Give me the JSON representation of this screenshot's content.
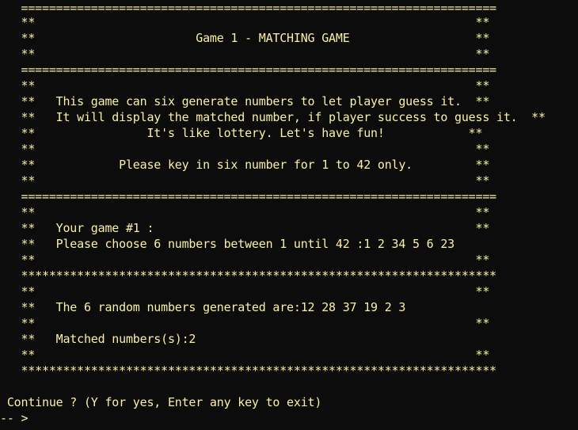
{
  "console": {
    "lines": [
      "   ====================================================================",
      "   **                                                               **",
      "   **                       Game 1 - MATCHING GAME                  **",
      "   **                                                               **",
      "",
      "   ====================================================================",
      "   **                                                               **",
      "   **   This game can six generate numbers to let player guess it.  **",
      "   **   It will display the matched number, if player success to guess it.  **",
      "   **                It's like lottery. Let's have fun!            **",
      "   **                                                               **",
      "   **            Please key in six number for 1 to 42 only.         **",
      "   **                                                               **",
      "   ====================================================================",
      "   **                                                               **",
      "   **   Your game #1 :                                              **",
      "   **   Please choose 6 numbers between 1 until 42 :1 2 34 5 6 23",
      "   **                                                               **",
      "   ********************************************************************",
      "   **                                                               **",
      "   **   The 6 random numbers generated are:12 28 37 19 2 3",
      "   **                                                               **",
      "   **   Matched numbers(s):2",
      "   **                                                               **",
      "   ********************************************************************",
      "",
      " Continue ? (Y for yes, Enter any key to exit)",
      "-- >"
    ]
  }
}
